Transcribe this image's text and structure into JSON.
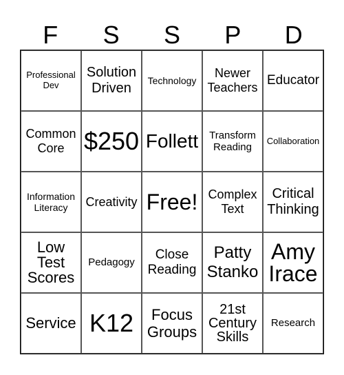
{
  "header": [
    "F",
    "S",
    "S",
    "P",
    "D"
  ],
  "cells": [
    [
      "Professional Dev",
      "Solution Driven",
      "Technology",
      "Newer Teachers",
      "Educator"
    ],
    [
      "Common Core",
      "$250",
      "Follett",
      "Transform Reading",
      "Collaboration"
    ],
    [
      "Information Literacy",
      "Creativity",
      "Free!",
      "Complex Text",
      "Critical Thinking"
    ],
    [
      "Low Test Scores",
      "Pedagogy",
      "Close Reading",
      "Patty Stanko",
      "Amy Irace"
    ],
    [
      "Service",
      "K12",
      "Focus Groups",
      "21st Century Skills",
      "Research"
    ]
  ]
}
